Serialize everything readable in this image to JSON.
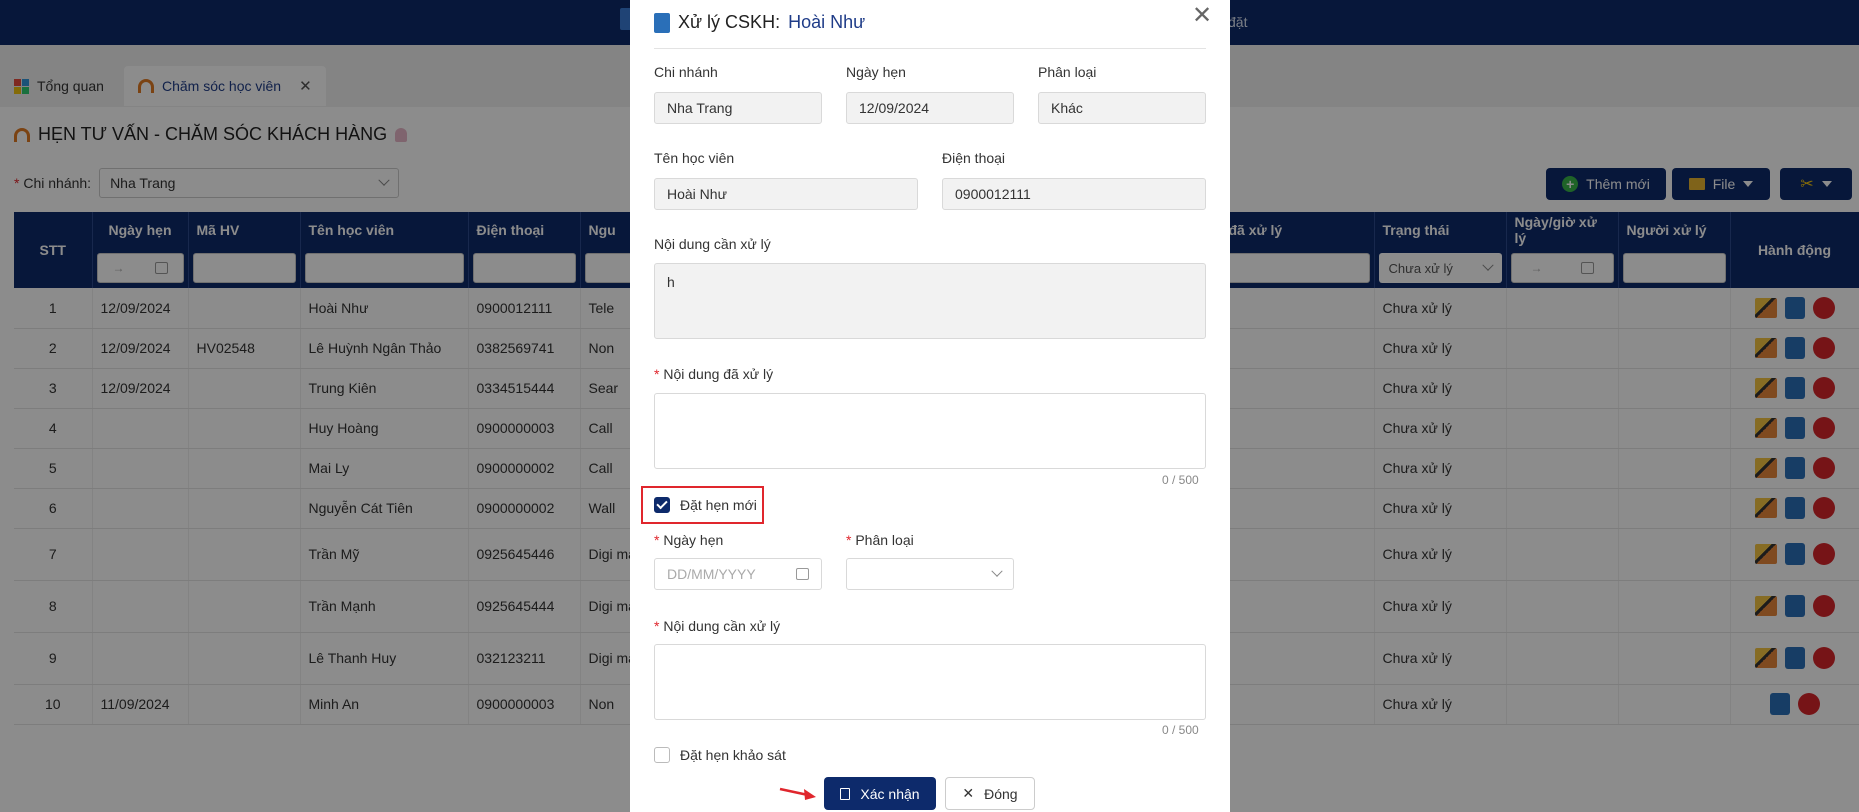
{
  "topbar": {
    "right_text": "đặt"
  },
  "tabs": [
    {
      "label": "Tổng quan"
    },
    {
      "label": "Chăm sóc học viên"
    }
  ],
  "page": {
    "title": "HẸN TƯ VẤN - CHĂM SÓC KHÁCH HÀNG",
    "branch_label": "Chi nhánh:",
    "branch_value": "Nha Trang"
  },
  "toolbar": {
    "add_label": "Thêm mới",
    "file_label": "File"
  },
  "table": {
    "headers": [
      "STT",
      "Ngày hẹn",
      "Mã HV",
      "Tên học viên",
      "Điện thoại",
      "Ngu",
      "đã xử lý",
      "Trạng thái",
      "Ngày/giờ xử lý",
      "Người xử lý",
      "Hành động"
    ],
    "status_filter": "Chưa xử lý",
    "rows": [
      {
        "stt": "1",
        "date": "12/09/2024",
        "code": "",
        "name": "Hoài Như",
        "phone": "0900012111",
        "src": "Tele",
        "status": "Chưa xử lý"
      },
      {
        "stt": "2",
        "date": "12/09/2024",
        "code": "HV02548",
        "name": "Lê Huỳnh Ngân Thảo",
        "phone": "0382569741",
        "src": "Non",
        "status": "Chưa xử lý"
      },
      {
        "stt": "3",
        "date": "12/09/2024",
        "code": "",
        "name": "Trung Kiên",
        "phone": "0334515444",
        "src": "Sear",
        "status": "Chưa xử lý"
      },
      {
        "stt": "4",
        "date": "",
        "code": "",
        "name": "Huy Hoàng",
        "phone": "0900000003",
        "src": "Call",
        "status": "Chưa xử lý"
      },
      {
        "stt": "5",
        "date": "",
        "code": "",
        "name": "Mai Ly",
        "phone": "0900000002",
        "src": "Call",
        "status": "Chưa xử lý"
      },
      {
        "stt": "6",
        "date": "",
        "code": "",
        "name": "Nguyễn Cát Tiên",
        "phone": "0900000002",
        "src": "Wall",
        "status": "Chưa xử lý"
      },
      {
        "stt": "7",
        "date": "",
        "code": "",
        "name": "Trần Mỹ",
        "phone": "0925645446",
        "src": "Digi man",
        "status": "Chưa xử lý"
      },
      {
        "stt": "8",
        "date": "",
        "code": "",
        "name": "Trần Mạnh",
        "phone": "0925645444",
        "src": "Digi man",
        "status": "Chưa xử lý"
      },
      {
        "stt": "9",
        "date": "",
        "code": "",
        "name": "Lê Thanh Huy",
        "phone": "032123211",
        "src": "Digi man",
        "status": "Chưa xử lý"
      },
      {
        "stt": "10",
        "date": "11/09/2024",
        "code": "",
        "name": "Minh An",
        "phone": "0900000003",
        "src": "Non",
        "status": "Chưa xử lý"
      }
    ]
  },
  "modal": {
    "title_prefix": "Xử lý CSKH:",
    "title_name": "Hoài Như",
    "branch_label": "Chi nhánh",
    "branch_value": "Nha Trang",
    "date_label": "Ngày hẹn",
    "date_value": "12/09/2024",
    "category_label": "Phân loại",
    "category_value": "Khác",
    "student_label": "Tên học viên",
    "student_value": "Hoài Như",
    "phone_label": "Điện thoại",
    "phone_value": "0900012111",
    "content_label": "Nội dung cần xử lý",
    "content_value": "h",
    "handled_label": "Nội dung đã xử lý",
    "handled_value": "",
    "counter1": "0 / 500",
    "new_appt_label": "Đặt hẹn mới",
    "new_appt_checked": true,
    "new_date_label": "Ngày hẹn",
    "new_date_placeholder": "DD/MM/YYYY",
    "new_category_label": "Phân loại",
    "new_content_label": "Nội dung cần xử lý",
    "counter2": "0 / 500",
    "survey_label": "Đặt hẹn khảo sát",
    "confirm_label": "Xác nhận",
    "close_label": "Đóng"
  }
}
